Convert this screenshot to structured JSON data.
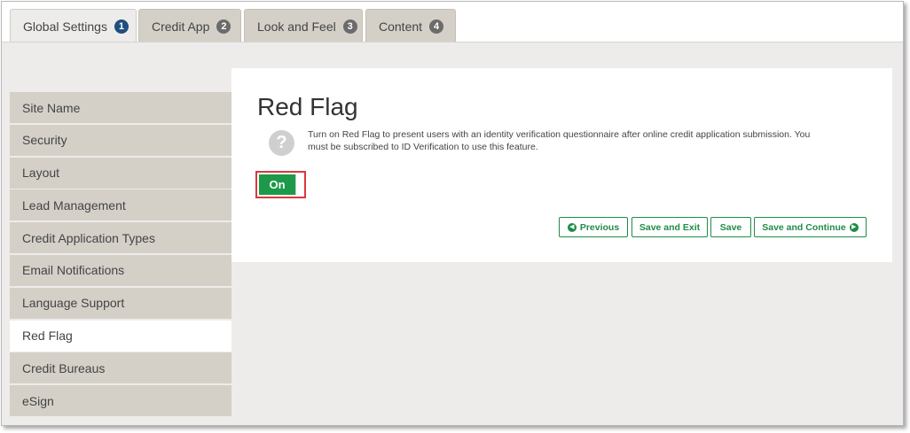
{
  "tabs": [
    {
      "label": "Global Settings",
      "badge": "1",
      "active": true
    },
    {
      "label": "Credit App",
      "badge": "2",
      "active": false
    },
    {
      "label": "Look and Feel",
      "badge": "3",
      "active": false
    },
    {
      "label": "Content",
      "badge": "4",
      "active": false
    }
  ],
  "sidebar": {
    "items": [
      {
        "label": "Site Name"
      },
      {
        "label": "Security"
      },
      {
        "label": "Layout"
      },
      {
        "label": "Lead Management"
      },
      {
        "label": "Credit Application Types"
      },
      {
        "label": "Email Notifications"
      },
      {
        "label": "Language Support"
      },
      {
        "label": "Red Flag",
        "active": true
      },
      {
        "label": "Credit Bureaus"
      },
      {
        "label": "eSign"
      }
    ]
  },
  "panel": {
    "title": "Red Flag",
    "help_icon": "question-circle-icon",
    "help_text": "Turn on Red Flag to present users with an identity verification questionnaire after online credit application submission. You must be subscribed to ID Verification to use this feature.",
    "toggle_label": "On",
    "toggle_state": "on"
  },
  "actions": {
    "previous_label": "Previous",
    "save_exit_label": "Save and Exit",
    "save_label": "Save",
    "save_continue_label": "Save and Continue"
  },
  "colors": {
    "accent_green": "#1f8c46",
    "toggle_green": "#1c9a49",
    "active_badge": "#1e4f7f",
    "highlight_red": "#d9383c"
  }
}
